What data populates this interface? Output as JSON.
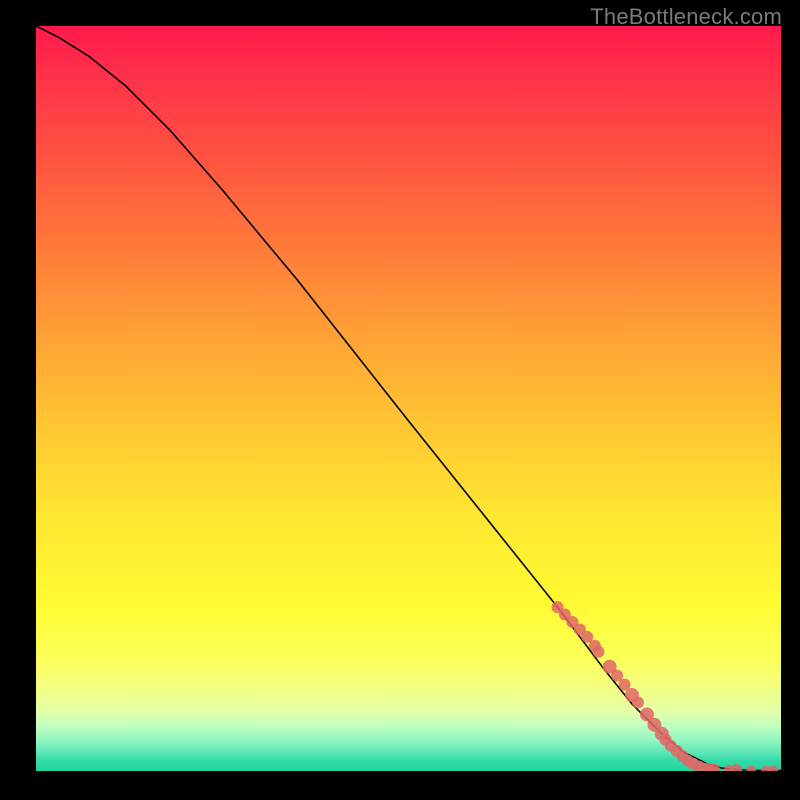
{
  "watermark": "TheBottleneck.com",
  "chart_data": {
    "type": "line",
    "title": "",
    "xlabel": "",
    "ylabel": "",
    "xlim": [
      0,
      100
    ],
    "ylim": [
      0,
      100
    ],
    "grid": false,
    "legend": false,
    "series": [
      {
        "name": "curve",
        "x": [
          0,
          3,
          7,
          12,
          18,
          25,
          35,
          50,
          62,
          70,
          76,
          80,
          84,
          87,
          90,
          92,
          94,
          96,
          98,
          100
        ],
        "y": [
          100,
          98.5,
          96,
          92,
          86,
          78,
          66,
          47,
          32,
          22,
          14,
          9,
          5,
          2.5,
          1,
          0.4,
          0.2,
          0.1,
          0.05,
          0.05
        ]
      }
    ],
    "markers": {
      "name": "cluster-dots",
      "x": [
        70,
        71,
        72,
        73,
        74,
        75,
        75.5,
        77,
        78,
        79,
        80,
        80.8,
        82,
        83,
        84,
        84.5,
        85.2,
        86,
        86.8,
        87.5,
        88.2,
        89,
        90,
        90.5,
        91,
        93,
        94,
        96,
        98,
        99
      ],
      "y": [
        22,
        21,
        20,
        19,
        18,
        16.8,
        16,
        14,
        12.8,
        11.6,
        10.2,
        9.2,
        7.6,
        6.2,
        5,
        4.2,
        3.4,
        2.7,
        2,
        1.4,
        1,
        0.6,
        0.3,
        0.25,
        0.2,
        0.15,
        0.12,
        0.1,
        0.08,
        0.06
      ],
      "radius": [
        6,
        6,
        6,
        6,
        6,
        6,
        6,
        7,
        6,
        6,
        7,
        6,
        7,
        7,
        7,
        6,
        6,
        6,
        6,
        6,
        6,
        6,
        6,
        5,
        6,
        5,
        6,
        5,
        5,
        5
      ]
    },
    "background_gradient": {
      "orientation": "vertical",
      "stops": [
        {
          "pos": 0.0,
          "color": "#ff1a4d"
        },
        {
          "pos": 0.3,
          "color": "#ff7b3a"
        },
        {
          "pos": 0.6,
          "color": "#ffe732"
        },
        {
          "pos": 0.85,
          "color": "#fbff59"
        },
        {
          "pos": 0.95,
          "color": "#8df5c0"
        },
        {
          "pos": 1.0,
          "color": "#1fd59f"
        }
      ]
    }
  }
}
